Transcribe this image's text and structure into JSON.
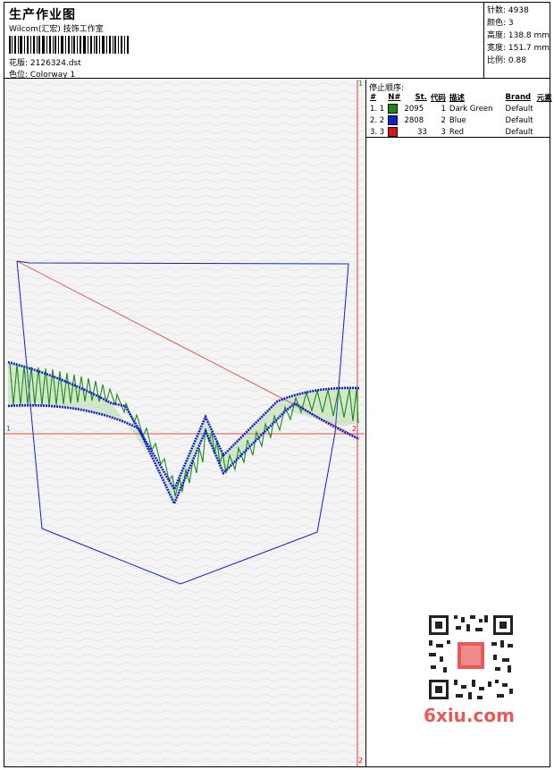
{
  "header": {
    "title": "生产作业图",
    "subtitle": "Wilcom(汇宏) 技饰工作室",
    "design_line": "花版: 2126324.dst",
    "colorway_line": "色位: Colorway 1"
  },
  "stats": {
    "stitches": "针数: 4938",
    "colors": "颜色: 3",
    "height": "高度: 138.8 mm",
    "width": "宽度: 151.7 mm",
    "scale": "比例: 0.88"
  },
  "stop_sequence": {
    "title": "停止顺序:",
    "columns": [
      "#",
      "N#",
      "St.",
      "代码",
      "描述",
      "Brand",
      "元素"
    ],
    "rows": [
      {
        "num": "1. 1",
        "color": "#1a8a1a",
        "stitches": "2095",
        "code": "1",
        "desc": "Dark Green",
        "brand": "Default"
      },
      {
        "num": "2. 2",
        "color": "#1020d0",
        "stitches": "2808",
        "code": "2",
        "desc": "Blue",
        "brand": "Default"
      },
      {
        "num": "3. 3",
        "color": "#e01010",
        "stitches": "33",
        "code": "3",
        "desc": "Red",
        "brand": "Default"
      }
    ]
  },
  "markers": {
    "top": "1",
    "bottom": "2",
    "left": "1",
    "right": "2"
  },
  "watermark": "6xiu.com",
  "colors": {
    "green": "#1a8a1a",
    "blue": "#1020d0",
    "red": "#e01010"
  }
}
